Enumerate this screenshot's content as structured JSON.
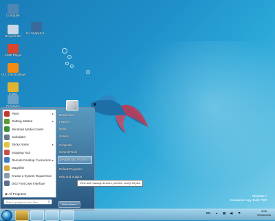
{
  "desktop": {
    "icons": [
      {
        "label": "Computer"
      },
      {
        "label": "Recycle Bin"
      },
      {
        "label": "Rx Snapshot..."
      },
      {
        "label": "AIMP Player"
      },
      {
        "label": "VLC media player"
      },
      {
        "label": "Folder"
      },
      {
        "label": "Programs"
      }
    ]
  },
  "start_menu": {
    "programs": [
      {
        "label": "Paint",
        "has_arrow": true
      },
      {
        "label": "Getting Started",
        "has_arrow": true
      },
      {
        "label": "Windows Media Center",
        "has_arrow": false
      },
      {
        "label": "Calculator",
        "has_arrow": false
      },
      {
        "label": "Sticky Notes",
        "has_arrow": true
      },
      {
        "label": "Snipping Tool",
        "has_arrow": false
      },
      {
        "label": "Remote Desktop Connection",
        "has_arrow": true
      },
      {
        "label": "Magnifier",
        "has_arrow": false
      },
      {
        "label": "Create a System Repair Disc",
        "has_arrow": false
      },
      {
        "label": "DX2 Font User Interface",
        "has_arrow": false
      }
    ],
    "all_programs": "All Programs",
    "search_placeholder": "Search programs and files",
    "right_items": [
      {
        "label": "Documents"
      },
      {
        "label": "Pictures"
      },
      {
        "label": "Music"
      },
      {
        "label": "Games"
      },
      {
        "label": "Computer"
      },
      {
        "label": "Control Panel"
      },
      {
        "label": "Devices and Printers"
      },
      {
        "label": "Default Programs"
      },
      {
        "label": "Help and Support"
      }
    ],
    "shutdown_label": "Shut down"
  },
  "tooltip": "View and manage devices, printers, and print jobs",
  "watermark": {
    "line1": "Windows 7",
    "line2": "Evaluation copy. Build 7000"
  },
  "clock": {
    "time": "3:05",
    "date": "22/05/2009"
  },
  "tray": {
    "lang": "EN"
  }
}
